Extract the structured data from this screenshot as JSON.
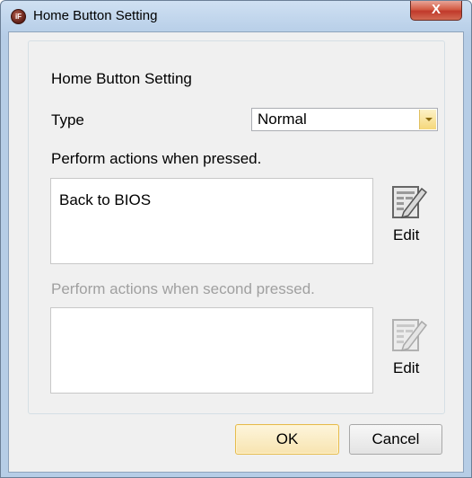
{
  "window": {
    "title": "Home Button Setting",
    "close_label": "X",
    "app_icon_text": "iF"
  },
  "group": {
    "legend": "Home Button Setting",
    "type_label": "Type",
    "type_value": "Normal",
    "pressed_label": "Perform actions when pressed.",
    "pressed_items": [
      "Back to BIOS"
    ],
    "second_label": "Perform actions when second pressed.",
    "second_items": [],
    "edit_label": "Edit"
  },
  "buttons": {
    "ok": "OK",
    "cancel": "Cancel"
  },
  "colors": {
    "title_accent": "#c0392b",
    "ok_border": "#e6bb4c",
    "disabled_text": "#a0a0a0"
  }
}
